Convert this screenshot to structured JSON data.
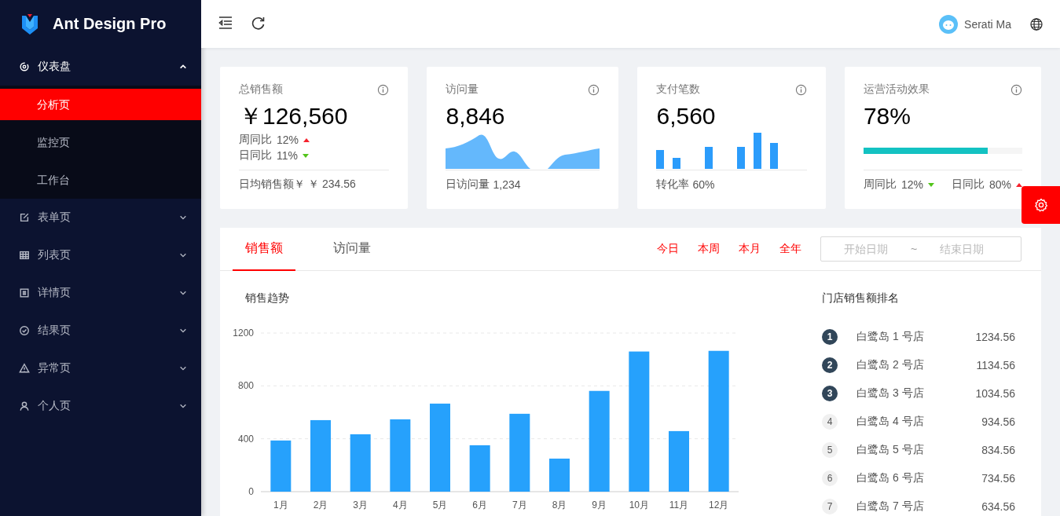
{
  "sidebar": {
    "logo_text": "Ant Design Pro",
    "items": [
      {
        "label": "仪表盘",
        "kind": "dashboard",
        "expanded": true,
        "children": [
          {
            "label": "分析页",
            "selected": true
          },
          {
            "label": "监控页",
            "selected": false
          },
          {
            "label": "工作台",
            "selected": false
          }
        ]
      },
      {
        "label": "表单页",
        "kind": "form",
        "expanded": false
      },
      {
        "label": "列表页",
        "kind": "table",
        "expanded": false
      },
      {
        "label": "详情页",
        "kind": "profile",
        "expanded": false
      },
      {
        "label": "结果页",
        "kind": "result",
        "expanded": false
      },
      {
        "label": "异常页",
        "kind": "warning",
        "expanded": false
      },
      {
        "label": "个人页",
        "kind": "user",
        "expanded": false
      }
    ]
  },
  "header": {
    "user_name": "Serati Ma"
  },
  "stat_cards": [
    {
      "kind": "trend",
      "title": "总销售额",
      "value": "￥126,560",
      "trends": [
        {
          "label": "周同比",
          "value": "12%",
          "up": true
        },
        {
          "label": "日同比",
          "value": "11%",
          "up": false
        }
      ],
      "footer_label": "日均销售额￥",
      "footer_value": "￥ 234.56"
    },
    {
      "kind": "area",
      "title": "访问量",
      "value": "8,846",
      "footer_label": "日访问量",
      "footer_value": "1,234"
    },
    {
      "kind": "bars",
      "title": "支付笔数",
      "value": "6,560",
      "footer_label": "转化率",
      "footer_value": "60%"
    },
    {
      "kind": "progress",
      "title": "运营活动效果",
      "value": "78%",
      "level": 0.78,
      "trends": [
        {
          "label": "周同比",
          "value": "12%",
          "up": false
        },
        {
          "label": "日同比",
          "value": "80%",
          "up": true
        }
      ]
    }
  ],
  "sales_card": {
    "tabs": [
      {
        "label": "销售额",
        "selected": true
      },
      {
        "label": "访问量",
        "selected": false
      }
    ],
    "ranges": [
      "今日",
      "本周",
      "本月",
      "全年"
    ],
    "date_range": {
      "start_placeholder": "开始日期",
      "separator": "~",
      "end_placeholder": "结束日期"
    },
    "chart_data": {
      "type": "bar",
      "title": "销售趋势",
      "categories": [
        "1月",
        "2月",
        "3月",
        "4月",
        "5月",
        "6月",
        "7月",
        "8月",
        "9月",
        "10月",
        "11月",
        "12月"
      ],
      "series": [
        {
          "color": "#26a1fc",
          "values": [
            387,
            541,
            434,
            547,
            666,
            351,
            589,
            250,
            762,
            1060,
            458,
            1065
          ]
        }
      ],
      "ylim": [
        0,
        1200
      ],
      "yticks": [
        0,
        400,
        800,
        1200
      ]
    },
    "ranking": {
      "title": "门店销售额排名",
      "items": [
        {
          "rank": "1",
          "name": "白鹭岛 1 号店",
          "amount": "1234.56",
          "highlighted": true
        },
        {
          "rank": "2",
          "name": "白鹭岛 2 号店",
          "amount": "1134.56",
          "highlighted": true
        },
        {
          "rank": "3",
          "name": "白鹭岛 3 号店",
          "amount": "1034.56",
          "highlighted": true
        },
        {
          "rank": "4",
          "name": "白鹭岛 4 号店",
          "amount": "934.56",
          "highlighted": false
        },
        {
          "rank": "5",
          "name": "白鹭岛 5 号店",
          "amount": "834.56",
          "highlighted": false
        },
        {
          "rank": "6",
          "name": "白鹭岛 6 号店",
          "amount": "734.56",
          "highlighted": false
        },
        {
          "rank": "7",
          "name": "白鹭岛 7 号店",
          "amount": "634.56",
          "highlighted": false
        }
      ]
    }
  }
}
